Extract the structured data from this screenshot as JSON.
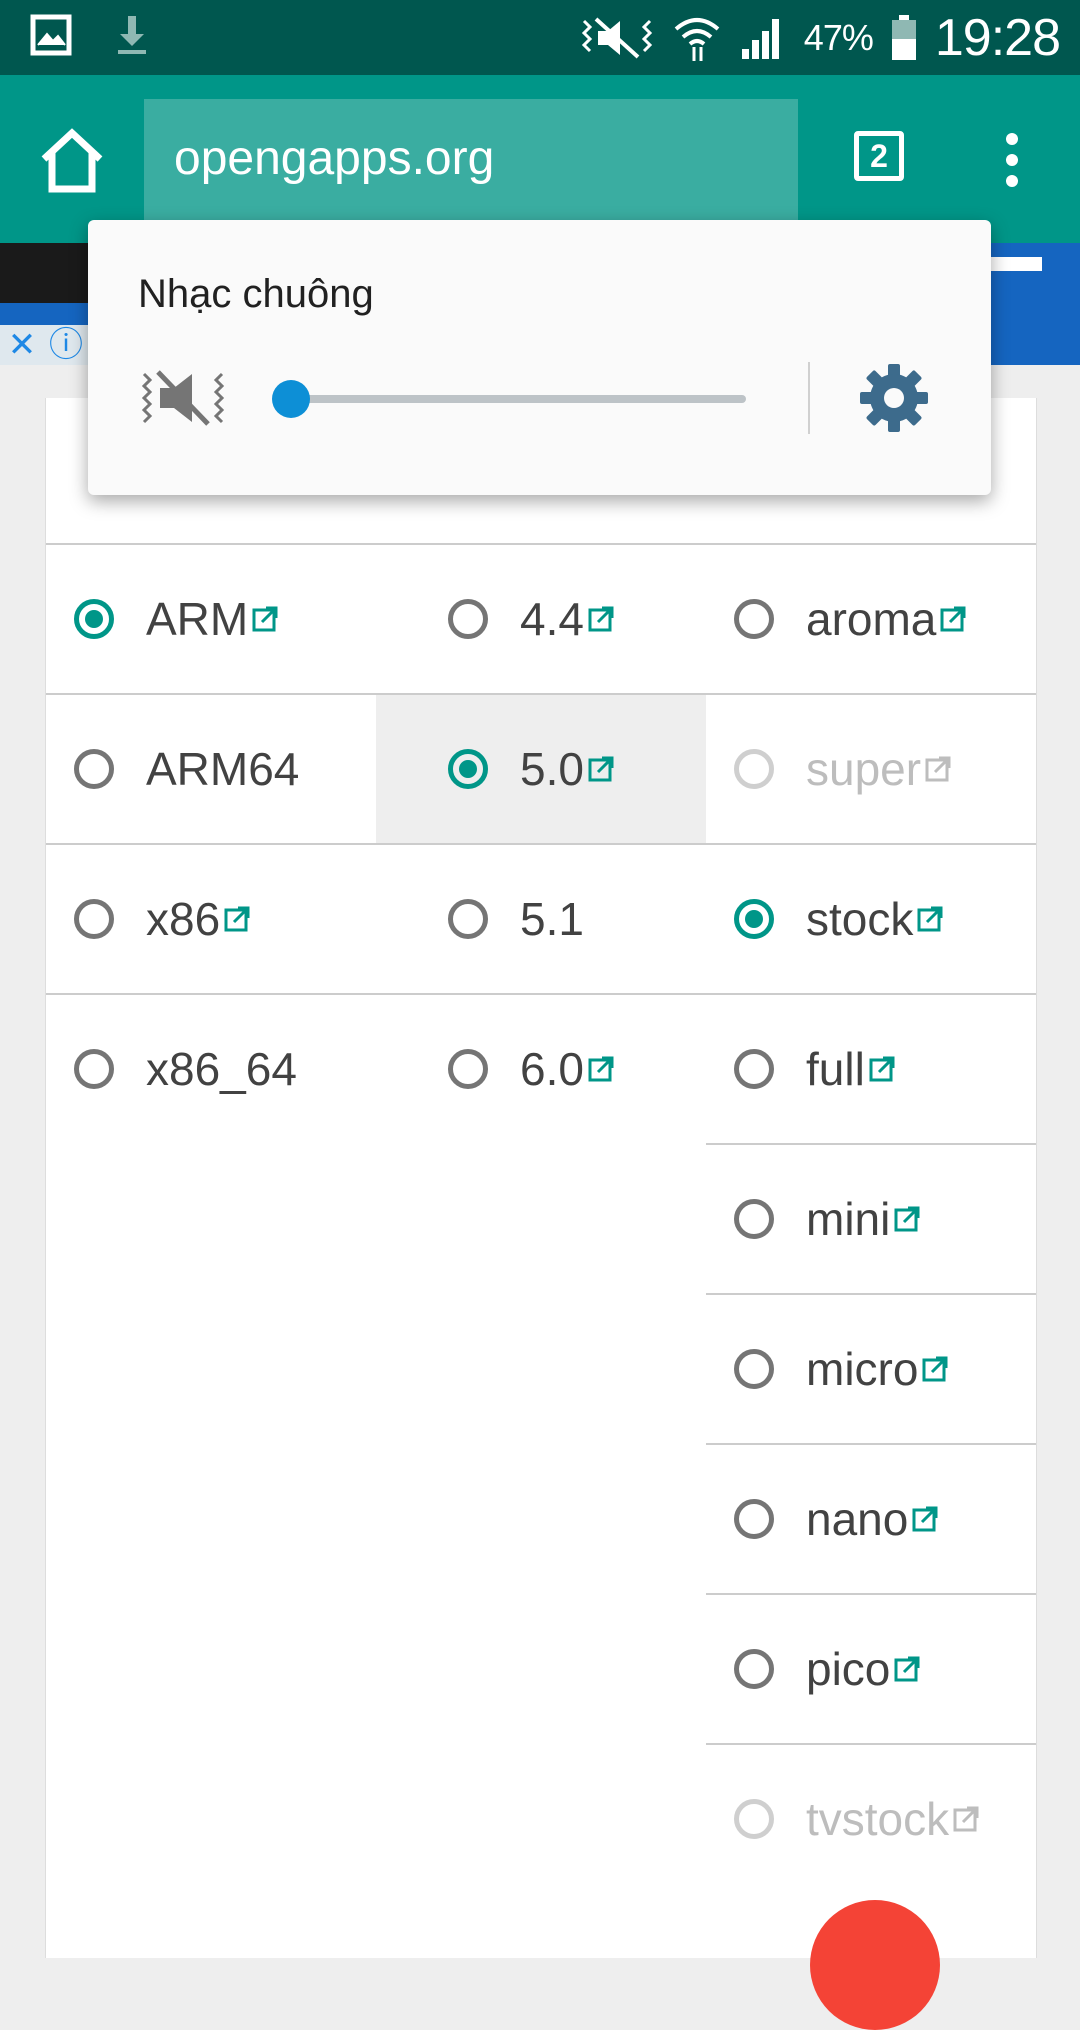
{
  "status_bar": {
    "battery_percent": "47%",
    "time": "19:28"
  },
  "browser": {
    "url": "opengapps.org",
    "tab_count": "2"
  },
  "volume_popup": {
    "title": "Nhạc chuông",
    "level_fraction": 0.0,
    "muted": true
  },
  "options": {
    "platform": [
      {
        "label": "ARM",
        "checked": true,
        "link": true
      },
      {
        "label": "ARM64",
        "checked": false,
        "link": false
      },
      {
        "label": "x86",
        "checked": false,
        "link": true
      },
      {
        "label": "x86_64",
        "checked": false,
        "link": false
      }
    ],
    "android": [
      {
        "label": "4.4",
        "checked": false,
        "link": true
      },
      {
        "label": "5.0",
        "checked": true,
        "link": true
      },
      {
        "label": "5.1",
        "checked": false,
        "link": false
      },
      {
        "label": "6.0",
        "checked": false,
        "link": true
      }
    ],
    "variant": [
      {
        "label": "aroma",
        "checked": false,
        "link": true
      },
      {
        "label": "super",
        "checked": false,
        "link": true,
        "disabled": true
      },
      {
        "label": "stock",
        "checked": true,
        "link": true
      },
      {
        "label": "full",
        "checked": false,
        "link": true
      },
      {
        "label": "mini",
        "checked": false,
        "link": true
      },
      {
        "label": "micro",
        "checked": false,
        "link": true
      },
      {
        "label": "nano",
        "checked": false,
        "link": true
      },
      {
        "label": "pico",
        "checked": false,
        "link": true
      },
      {
        "label": "tvstock",
        "checked": false,
        "link": true,
        "disabled": true
      }
    ]
  },
  "colors": {
    "accent": "#009688",
    "status_bar": "#00574f",
    "slider": "#0d8fd6",
    "gear": "#3d6b8c"
  }
}
